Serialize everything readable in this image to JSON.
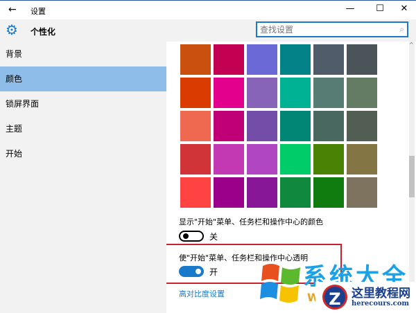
{
  "window": {
    "title": "设置",
    "back_icon": "←",
    "min_icon": "—",
    "max_icon": "☐",
    "close_icon": "✕"
  },
  "header": {
    "title": "个性化",
    "search_placeholder": "查找设置"
  },
  "sidebar": {
    "items": [
      {
        "label": "背景"
      },
      {
        "label": "颜色",
        "selected": true
      },
      {
        "label": "锁屏界面"
      },
      {
        "label": "主题"
      },
      {
        "label": "开始"
      }
    ]
  },
  "swatches": [
    "#d0a888",
    "#c07898",
    "#9f9fe0",
    "#70b8b8",
    "#8a9098",
    "#888e92",
    "#ca5010",
    "#c30052",
    "#6b69d6",
    "#038387",
    "#515c6b",
    "#4a5459",
    "#da3b01",
    "#e3008c",
    "#8764b8",
    "#00b294",
    "#567c73",
    "#647c64",
    "#ef6950",
    "#bf0077",
    "#744da9",
    "#018574",
    "#486860",
    "#525e54",
    "#d13438",
    "#c239b3",
    "#b146c2",
    "#00cc6a",
    "#498205",
    "#847545",
    "#ff4343",
    "#9a0089",
    "#881798",
    "#10893e",
    "#107c10",
    "#7e735f"
  ],
  "settings": {
    "show_color": {
      "label": "显示\"开始\"菜单、任务栏和操作中心的颜色",
      "state": "关",
      "on": false
    },
    "transparent": {
      "label": "使\"开始\"菜单、任务栏和操作中心透明",
      "state": "开",
      "on": true
    },
    "high_contrast_link": "高对比度设置"
  },
  "watermarks": {
    "site1": "系统大全",
    "site1_sub": "W",
    "site2": "这里教程网",
    "site2_url": "herecours.com"
  }
}
